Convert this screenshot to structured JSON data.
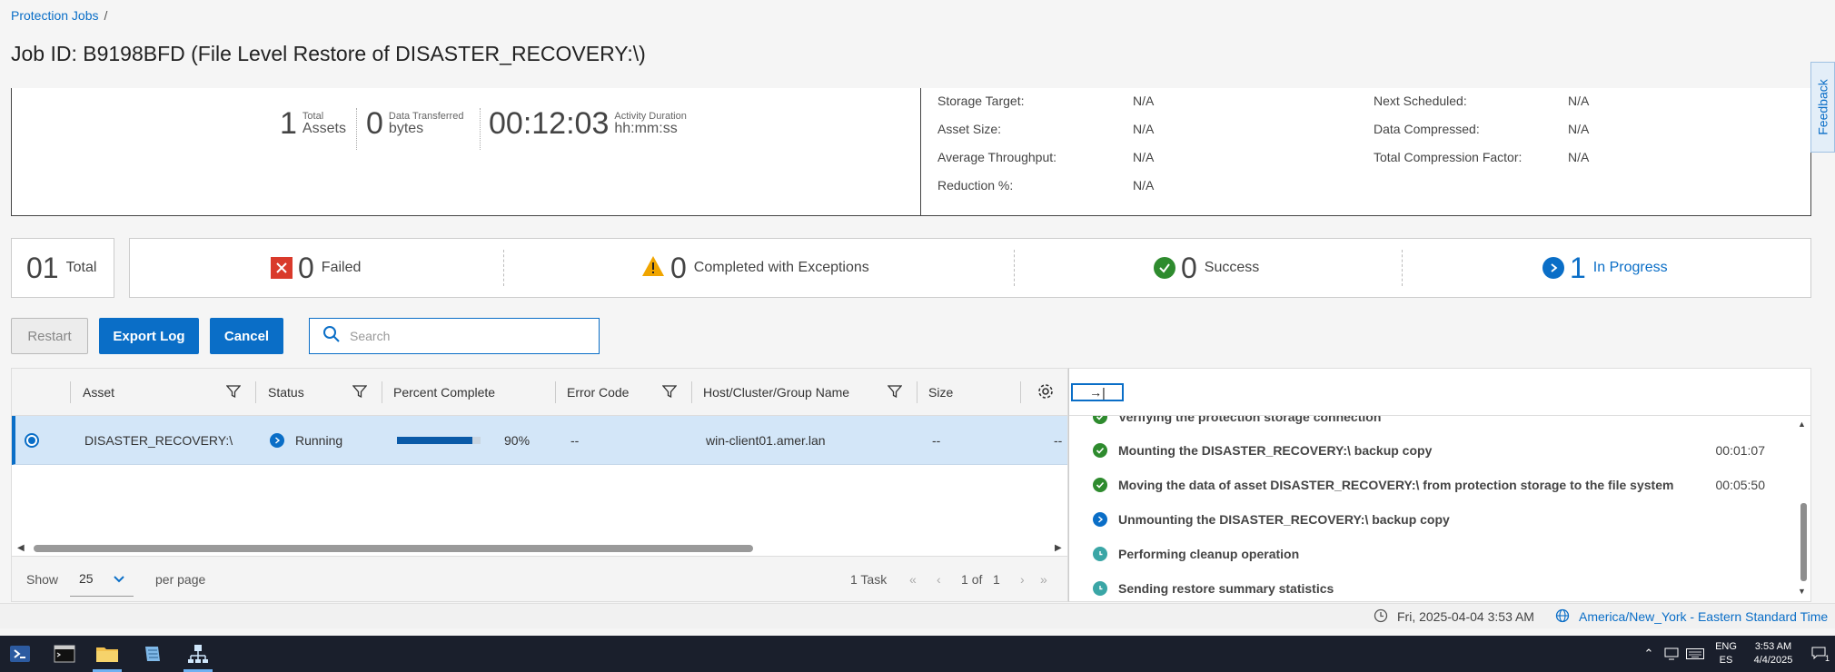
{
  "breadcrumb": {
    "link": "Protection Jobs",
    "separator": "/"
  },
  "title": "Job ID: B9198BFD (File Level Restore of DISASTER_RECOVERY:\\)",
  "summary": {
    "stats": [
      {
        "value": "1",
        "small": "Total",
        "label": "Assets"
      },
      {
        "value": "0",
        "small": "Data Transferred",
        "label": "bytes"
      },
      {
        "value": "00:12:03",
        "small": "Activity Duration",
        "label": "hh:mm:ss"
      }
    ],
    "details_left": [
      {
        "key": "Storage Target:",
        "value": "N/A"
      },
      {
        "key": "Asset Size:",
        "value": "N/A"
      },
      {
        "key": "Average Throughput:",
        "value": "N/A"
      },
      {
        "key": "Reduction %:",
        "value": "N/A"
      }
    ],
    "details_right": [
      {
        "key": "Next Scheduled:",
        "value": "N/A"
      },
      {
        "key": "Data Compressed:",
        "value": "N/A"
      },
      {
        "key": "Total Compression Factor:",
        "value": "N/A"
      }
    ]
  },
  "counts": {
    "total": {
      "value": "01",
      "label": "Total"
    },
    "failed": {
      "value": "0",
      "label": "Failed"
    },
    "exceptions": {
      "value": "0",
      "label": "Completed with Exceptions"
    },
    "success": {
      "value": "0",
      "label": "Success"
    },
    "in_progress": {
      "value": "1",
      "label": "In Progress"
    }
  },
  "toolbar": {
    "restart": "Restart",
    "export_log": "Export Log",
    "cancel": "Cancel",
    "search_placeholder": "Search"
  },
  "table": {
    "columns": [
      "Asset",
      "Status",
      "Percent Complete",
      "Error Code",
      "Host/Cluster/Group Name",
      "Size"
    ],
    "row": {
      "asset": "DISASTER_RECOVERY:\\",
      "status": "Running",
      "percent": 0.9,
      "percent_label": "90%",
      "error_code": "--",
      "host": "win-client01.amer.lan",
      "size": "--",
      "extra": "--"
    },
    "footer": {
      "show": "Show",
      "page_size": "25",
      "per_page": "per page",
      "tasks": "1 Task",
      "page": "1",
      "of": "of",
      "pages": "1"
    }
  },
  "steps_panel": {
    "collapse_glyph": "→|",
    "partial_step": "Verifying the protection storage connection",
    "steps": [
      {
        "text": "Mounting the DISASTER_RECOVERY:\\ backup copy",
        "duration": "00:01:07",
        "state": "success"
      },
      {
        "text": "Moving the data of asset DISASTER_RECOVERY:\\ from protection storage to the file system",
        "duration": "00:05:50",
        "state": "success"
      },
      {
        "text": "Unmounting the DISASTER_RECOVERY:\\ backup copy",
        "duration": "",
        "state": "running"
      },
      {
        "text": "Performing cleanup operation",
        "duration": "",
        "state": "pending"
      },
      {
        "text": "Sending restore summary statistics",
        "duration": "",
        "state": "pending"
      }
    ]
  },
  "footer": {
    "datetime": "Fri, 2025-04-04 3:53 AM",
    "timezone": "America/New_York - Eastern Standard Time"
  },
  "feedback": "Feedback",
  "taskbar": {
    "lang_top": "ENG",
    "lang_bottom": "ES",
    "time": "3:53 AM",
    "date": "4/4/2025",
    "notification_count": "1"
  },
  "colors": {
    "accent": "#0a6ec7",
    "failed": "#d93a2b",
    "warning": "#f0a500",
    "success": "#2e8b2e",
    "pending": "#3aa6a6"
  }
}
